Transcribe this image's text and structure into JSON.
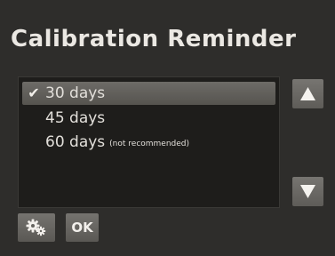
{
  "screen": {
    "title": "Calibration Reminder"
  },
  "list": {
    "items": [
      {
        "label": "30 days",
        "note": "",
        "selected": true,
        "check_icon": "checkmark-icon"
      },
      {
        "label": "45 days",
        "note": "",
        "selected": false
      },
      {
        "label": "60 days",
        "note": "(not recommended)",
        "selected": false
      }
    ]
  },
  "controls": {
    "scroll_up_icon": "arrow-up-icon",
    "scroll_down_icon": "arrow-down-icon",
    "settings_icon": "gears-icon",
    "ok_label": "OK"
  },
  "colors": {
    "background": "#2e2d2b",
    "list_background": "#1e1d1b",
    "selection": "#66645f",
    "text": "#ebe8e3"
  }
}
